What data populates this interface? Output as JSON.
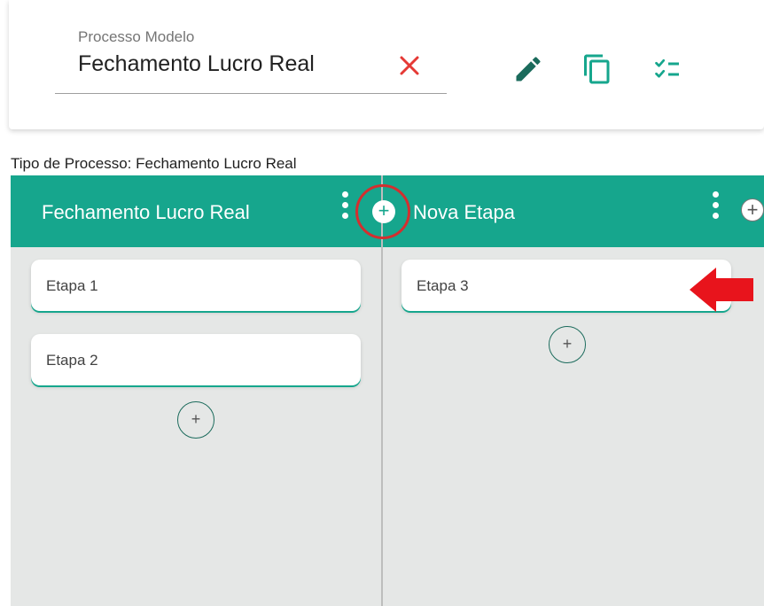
{
  "process_field": {
    "label": "Processo Modelo",
    "value": "Fechamento Lucro Real"
  },
  "toolbar": {
    "icons": [
      "close-icon",
      "pencil-icon",
      "copy-icon",
      "checklist-icon"
    ]
  },
  "process_type_label": "Tipo de Processo: Fechamento Lucro Real",
  "columns": [
    {
      "title": "Fechamento Lucro Real",
      "cards": [
        "Etapa 1",
        "Etapa 2"
      ]
    },
    {
      "title": "Nova Etapa",
      "cards": [
        "Etapa 3"
      ]
    }
  ],
  "add_symbol": "+",
  "colors": {
    "accent": "#16a68d",
    "column_bg": "#e5e7e6",
    "highlight": "#d32f2f",
    "clear": "#e53935"
  }
}
